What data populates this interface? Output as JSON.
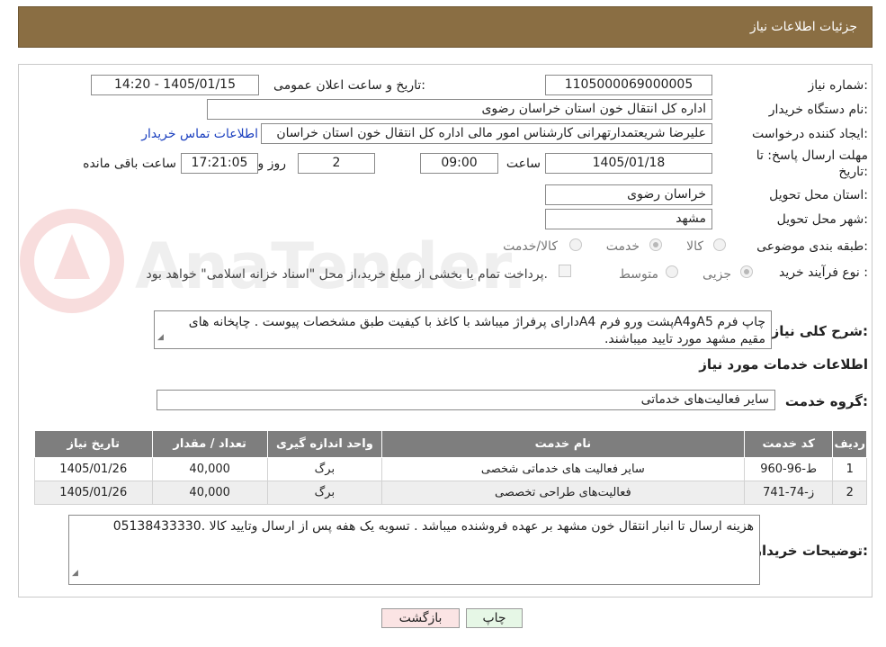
{
  "header": {
    "title": "جزئیات اطلاعات نیاز"
  },
  "form": {
    "need_number_label": "شماره نیاز:",
    "need_number": "1105000069000005",
    "announce_label": "تاریخ و ساعت اعلان عمومی:",
    "announce_value": "1405/01/15 - 14:20",
    "buyer_org_label": "نام دستگاه خریدار:",
    "buyer_org": "اداره کل انتقال خون استان خراسان رضوی",
    "requester_label": "ایجاد کننده درخواست:",
    "requester": "علیرضا شریعتمدارتهرانی کارشناس امور مالی اداره کل انتقال خون استان خراسان",
    "contact_link": "اطلاعات تماس خریدار",
    "deadline_label_1": "مهلت ارسال پاسخ: تا",
    "deadline_label_2": "تاریخ:",
    "deadline_date": "1405/01/18",
    "time_label": "ساعت",
    "deadline_time": "09:00",
    "days_value": "2",
    "days_label": "روز و",
    "remaining_time": "17:21:05",
    "remaining_label": "ساعت باقی مانده",
    "province_label": "استان محل تحویل:",
    "province": "خراسان رضوی",
    "city_label": "شهر محل تحویل:",
    "city": "مشهد",
    "category_label": "طبقه بندی موضوعی:",
    "category_options": [
      "کالا",
      "خدمت",
      "کالا/خدمت"
    ],
    "category_selected": "خدمت",
    "process_label": "نوع فرآیند خرید :",
    "process_options": [
      "جزیی",
      "متوسط"
    ],
    "process_selected": "جزیی",
    "payment_note": "پرداخت تمام یا بخشی از مبلغ خرید،از محل \"اسناد خزانه اسلامی\" خواهد بود.",
    "general_desc_label": "شرح کلی نیاز:",
    "general_desc": "چاپ فرم A5وA4پشت ورو فرم A4دارای پرفراژ میباشد با کاغذ با کیفیت طبق مشخصات پیوست . چاپخانه های مقیم مشهد مورد تایید میباشند.",
    "services_title": "اطلاعات خدمات مورد نیاز",
    "service_group_label": "گروه خدمت:",
    "service_group": "سایر فعالیت‌های خدماتی",
    "buyer_notes_label": "توضیحات خریدار:",
    "buyer_notes": "هزینه ارسال تا انبار انتقال خون مشهد بر عهده فروشنده میباشد . تسویه یک هفه پس از ارسال وتایید کالا .05138433330"
  },
  "table": {
    "headers": [
      "ردیف",
      "کد خدمت",
      "نام خدمت",
      "واحد اندازه گیری",
      "تعداد / مقدار",
      "تاریخ نیاز"
    ],
    "rows": [
      [
        "1",
        "ط-96-960",
        "سایر فعالیت های خدماتی شخصی",
        "برگ",
        "40,000",
        "1405/01/26"
      ],
      [
        "2",
        "ز-74-741",
        "فعالیت‌های طراحی تخصصی",
        "برگ",
        "40,000",
        "1405/01/26"
      ]
    ]
  },
  "buttons": {
    "print": "چاپ",
    "back": "بازگشت"
  },
  "watermark": {
    "text": "AnaTender.neT"
  },
  "colors": {
    "header_bg": "#8a6e43",
    "table_header_bg": "#7e7e7e",
    "print_btn_bg": "#e6f7e6",
    "back_btn_bg": "#fbe4e4",
    "link": "#1a3fbf"
  }
}
